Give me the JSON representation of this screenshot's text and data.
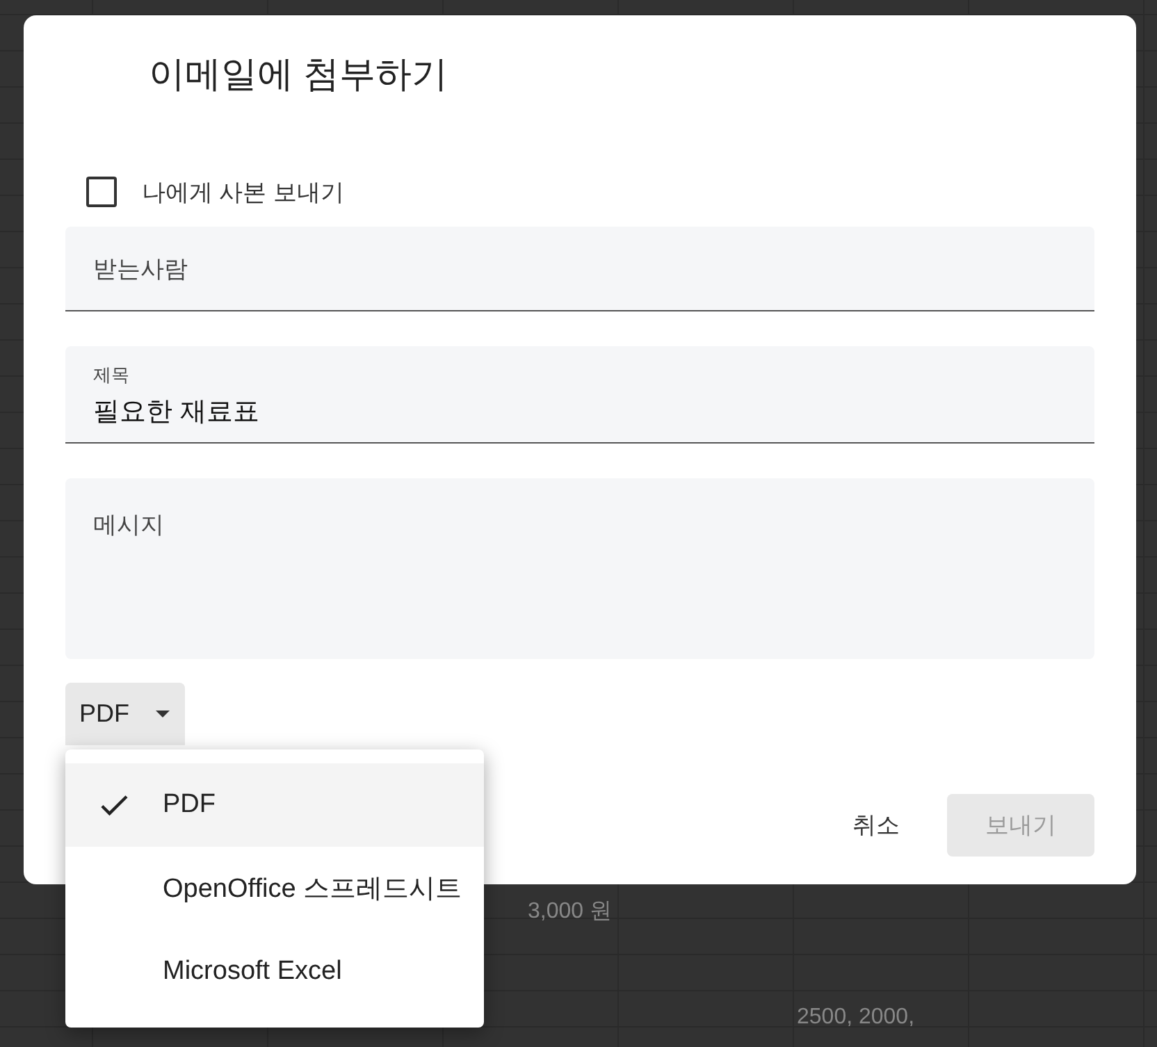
{
  "sheet_behind": {
    "cells": [
      {
        "text": "3,000 원"
      },
      {
        "text": "2500, 2000,"
      }
    ]
  },
  "dialog": {
    "title": "이메일에 첨부하기",
    "copy_to_me": {
      "label": "나에게 사본 보내기",
      "checked": false
    },
    "fields": [
      {
        "kind": "line",
        "label": "받는사람"
      },
      {
        "kind": "line",
        "label": "제목",
        "value": "필요한 재료표"
      },
      {
        "kind": "area",
        "label": "메시지"
      }
    ],
    "format": {
      "value": "PDF",
      "expanded": true,
      "options": [
        {
          "label": "PDF",
          "selected": true
        },
        {
          "label": "OpenOffice 스프레드시트",
          "selected": false
        },
        {
          "label": "Microsoft Excel",
          "selected": false
        }
      ]
    },
    "buttons": [
      {
        "label": "취소",
        "kind": "text",
        "disabled": false
      },
      {
        "label": "보내기",
        "kind": "filled",
        "disabled": true
      }
    ]
  }
}
